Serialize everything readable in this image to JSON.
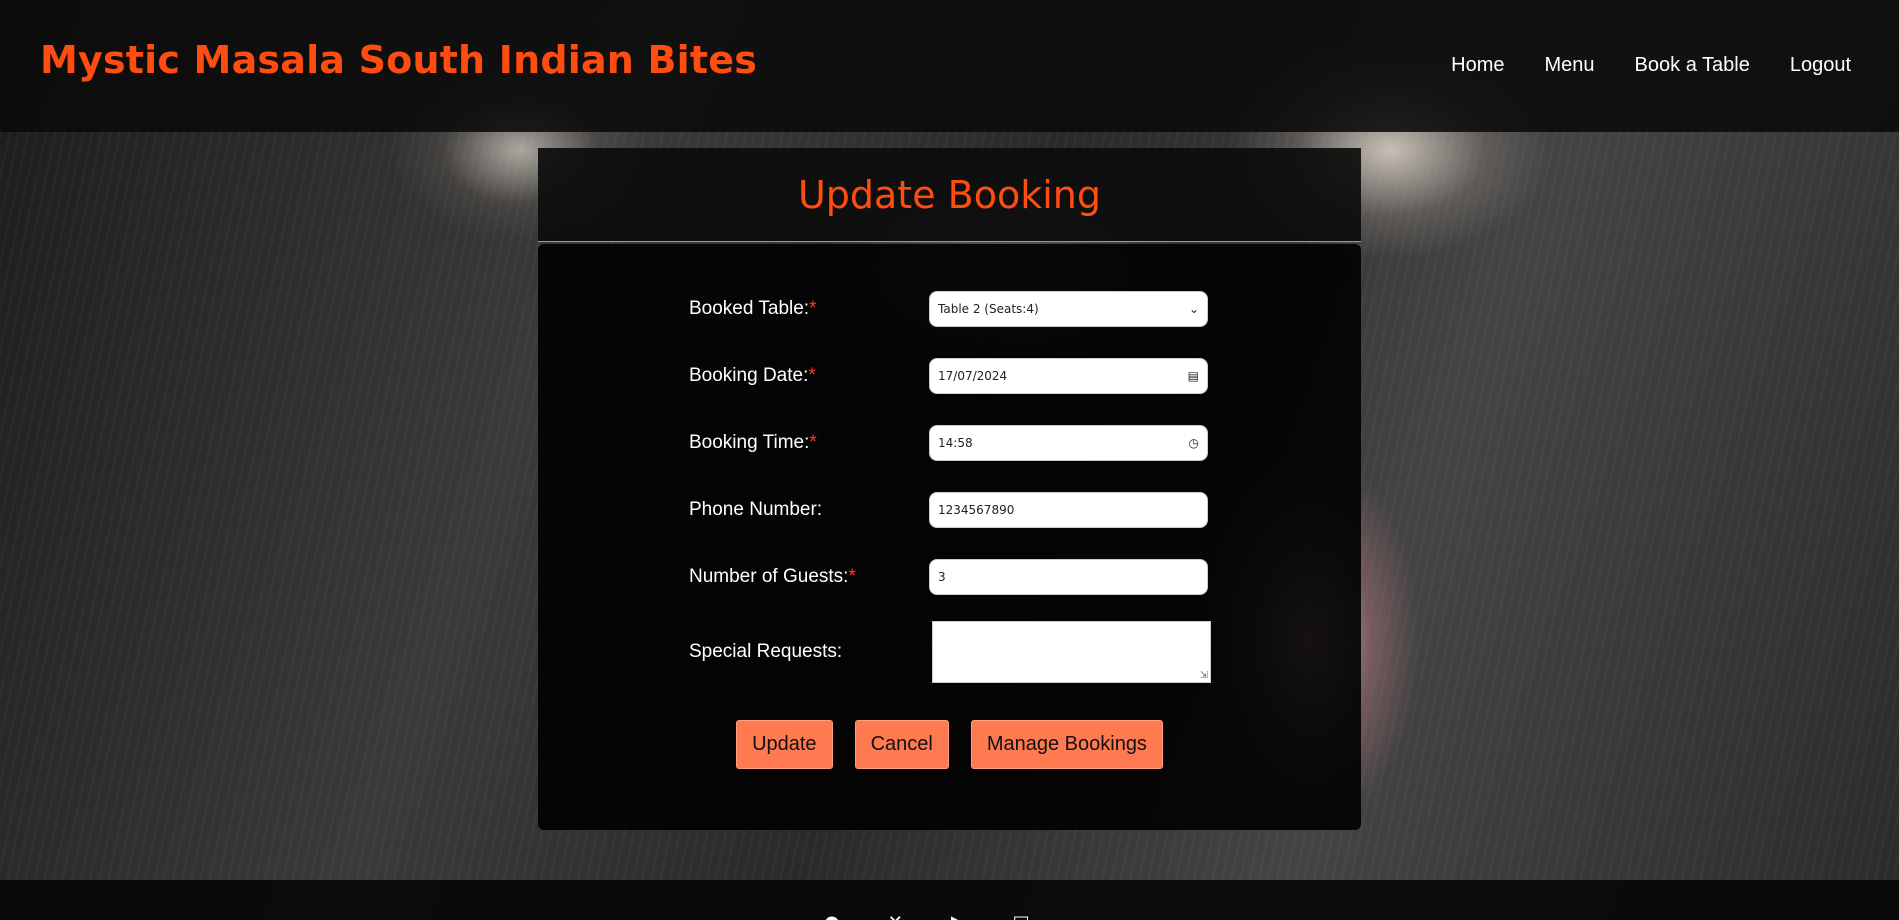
{
  "header": {
    "brand": "Mystic Masala South Indian Bites",
    "nav": [
      "Home",
      "Menu",
      "Book a Table",
      "Logout"
    ]
  },
  "page": {
    "title": "Update Booking"
  },
  "form": {
    "table": {
      "label": "Booked Table:",
      "required": "*",
      "value": "Table 2 (Seats:4)"
    },
    "date": {
      "label": "Booking Date:",
      "required": "*",
      "value": "17/07/2024"
    },
    "time": {
      "label": "Booking Time:",
      "required": "*",
      "value": "14:58"
    },
    "phone": {
      "label": "Phone Number:",
      "value": "1234567890"
    },
    "guests": {
      "label": "Number of Guests:",
      "required": "*",
      "value": "3"
    },
    "requests": {
      "label": "Special Requests:",
      "value": ""
    }
  },
  "buttons": {
    "update": "Update",
    "cancel": "Cancel",
    "manage": "Manage Bookings"
  },
  "footer": {
    "social_icons": [
      "facebook-icon",
      "x-twitter-icon",
      "youtube-icon",
      "instagram-icon"
    ]
  },
  "colors": {
    "brand": "#ff4d12",
    "button": "#ff7a50",
    "required": "#ff3b1e"
  }
}
